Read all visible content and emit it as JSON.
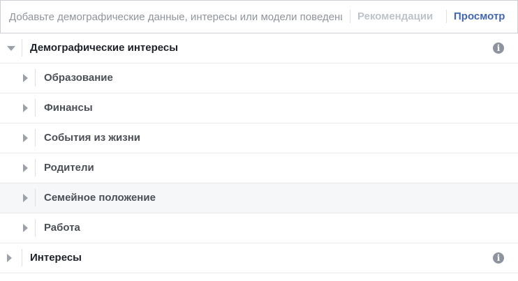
{
  "search": {
    "placeholder": "Добавьте демографические данные, интересы или модели поведения",
    "recommendations_label": "Рекомендации",
    "browse_label": "Просмотр"
  },
  "tree": {
    "demographics": {
      "label": "Демографические интересы",
      "expanded": true,
      "children": [
        {
          "label": "Образование"
        },
        {
          "label": "Финансы"
        },
        {
          "label": "События из жизни"
        },
        {
          "label": "Родители"
        },
        {
          "label": "Семейное положение"
        },
        {
          "label": "Работа"
        }
      ]
    },
    "interests": {
      "label": "Интересы",
      "expanded": false
    },
    "info_glyph": "i"
  },
  "icons": {
    "expanded": "caret-down-icon",
    "collapsed": "caret-right-icon",
    "info": "info-icon"
  },
  "colors": {
    "accent": "#4267b2",
    "disabled_text": "#bec3c9",
    "hover_row": "#f6f7f9"
  }
}
